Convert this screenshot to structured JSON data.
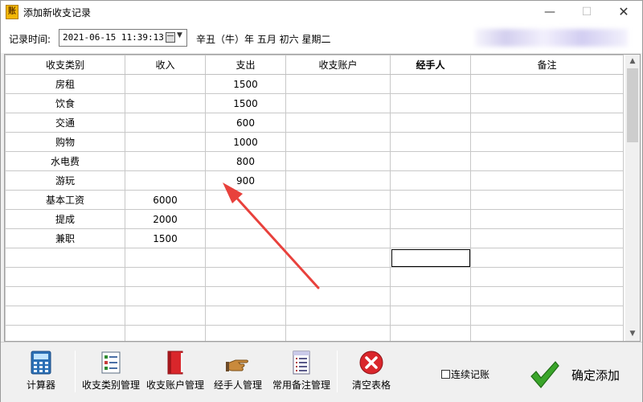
{
  "window": {
    "app_icon_text": "账",
    "title": "添加新收支记录",
    "minimize_glyph": "—",
    "maximize_glyph": "☐",
    "close_glyph": "✕"
  },
  "record_time": {
    "label": "记录时间:",
    "value": "2021-06-15 11:39:13",
    "lunar_date": "辛丑（牛）年 五月 初六 星期二"
  },
  "table": {
    "columns": [
      "收支类别",
      "收入",
      "支出",
      "收支账户",
      "经手人",
      "备注"
    ],
    "rows": [
      [
        "房租",
        "",
        "1500",
        "",
        "",
        ""
      ],
      [
        "饮食",
        "",
        "1500",
        "",
        "",
        ""
      ],
      [
        "交通",
        "",
        "600",
        "",
        "",
        ""
      ],
      [
        "购物",
        "",
        "1000",
        "",
        "",
        ""
      ],
      [
        "水电费",
        "",
        "800",
        "",
        "",
        ""
      ],
      [
        "游玩",
        "",
        "900",
        "",
        "",
        ""
      ],
      [
        "基本工资",
        "6000",
        "",
        "",
        "",
        ""
      ],
      [
        "提成",
        "2000",
        "",
        "",
        "",
        ""
      ],
      [
        "兼职",
        "1500",
        "",
        "",
        "",
        ""
      ],
      [
        "",
        "",
        "",
        "",
        "",
        ""
      ],
      [
        "",
        "",
        "",
        "",
        "",
        ""
      ],
      [
        "",
        "",
        "",
        "",
        "",
        ""
      ],
      [
        "",
        "",
        "",
        "",
        "",
        ""
      ],
      [
        "",
        "",
        "",
        "",
        "",
        ""
      ]
    ]
  },
  "toolbar": {
    "calculator": "计算器",
    "category_mgmt": "收支类别管理",
    "account_mgmt": "收支账户管理",
    "handler_mgmt": "经手人管理",
    "remark_mgmt": "常用备注管理",
    "clear_table": "清空表格",
    "continuous": "连续记账",
    "confirm": "确定添加"
  },
  "colors": {
    "accent_arrow": "#e8413c",
    "confirm_check": "#3aa52a",
    "clear_red": "#d9262b"
  }
}
